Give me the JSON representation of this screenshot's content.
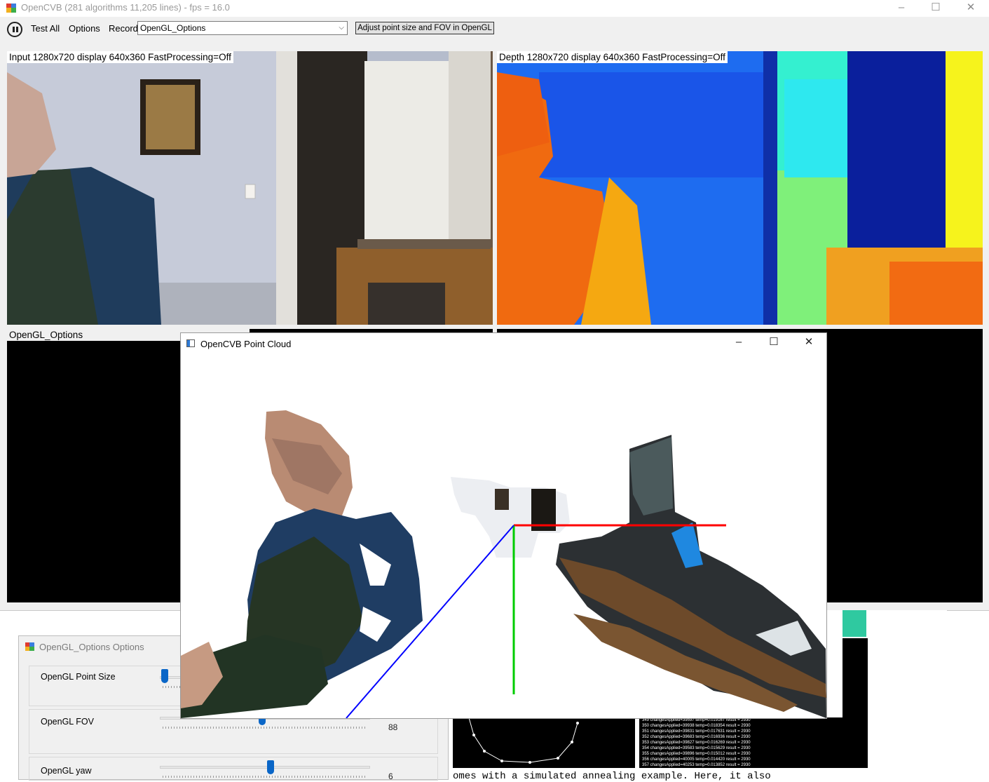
{
  "main_window": {
    "title": "OpenCVB (281 algorithms 11,205 lines) - fps = 16.0",
    "minimize": "–",
    "maximize": "☐",
    "close": "✕"
  },
  "toolbar": {
    "test_all": "Test All",
    "options": "Options",
    "record": "Record",
    "algorithm_selected": "OpenGL_Options",
    "action_button": "Adjust point size and FOV in OpenGL"
  },
  "panels": {
    "input_label": "Input 1280x720 display 640x360 FastProcessing=Off",
    "depth_label": "Depth 1280x720 display 640x360 FastProcessing=Off",
    "result_label": "OpenGL_Options"
  },
  "point_cloud_window": {
    "title": "OpenCVB Point Cloud",
    "minimize": "–",
    "maximize": "☐",
    "close": "✕"
  },
  "options_window": {
    "title": "OpenGL_Options Options",
    "sliders": [
      {
        "label": "OpenGL Point Size",
        "value": "",
        "fraction": 0.03
      },
      {
        "label": "OpenGL FOV",
        "value": "88",
        "fraction": 0.49
      },
      {
        "label": "OpenGL yaw",
        "value": "6",
        "fraction": 0.53
      }
    ]
  },
  "console_lines": [
    "349  changesApplied=39597 temp=0.019167 result = 2930",
    "350  changesApplied=39938 temp=0.018354 result = 2930",
    "351  changesApplied=39831 temp=0.017631 result = 2930",
    "352  changesApplied=39683 temp=0.016936 result = 2930",
    "353  changesApplied=39827 temp=0.016269 result = 2930",
    "354  changesApplied=39583 temp=0.015629 result = 2930",
    "355  changesApplied=39896 temp=0.015012 result = 2930",
    "356  changesApplied=40005 temp=0.014420 result = 2930",
    "357  changesApplied=40253 temp=0.013852 result = 2930"
  ],
  "background_text": "omes with a simulated annealing example.  Here, it also",
  "colors": {
    "axis_x": "#ff0000",
    "axis_y": "#00cc00",
    "axis_z": "#0000ff",
    "slider_thumb": "#0a66c7"
  },
  "icons": {
    "app": "opencvb-app-icon",
    "pause": "pause-icon",
    "dropdown": "chevron-down-icon"
  }
}
